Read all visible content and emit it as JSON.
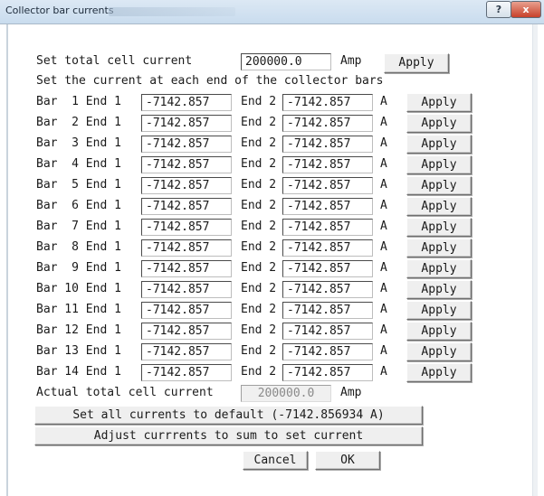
{
  "window": {
    "title": "Collector bar currents",
    "help_glyph": "?",
    "close_glyph": "x"
  },
  "total": {
    "label": "Set total cell current",
    "value": "200000.0",
    "unit": "Amp",
    "apply_label": "Apply"
  },
  "instruction": "Set the current at each end of the collector bars",
  "bars": [
    {
      "label": "Bar  1 End 1",
      "end1": "-7142.857",
      "end2_label": "End 2",
      "end2": "-7142.857",
      "unit": "A",
      "apply": "Apply"
    },
    {
      "label": "Bar  2 End 1",
      "end1": "-7142.857",
      "end2_label": "End 2",
      "end2": "-7142.857",
      "unit": "A",
      "apply": "Apply"
    },
    {
      "label": "Bar  3 End 1",
      "end1": "-7142.857",
      "end2_label": "End 2",
      "end2": "-7142.857",
      "unit": "A",
      "apply": "Apply"
    },
    {
      "label": "Bar  4 End 1",
      "end1": "-7142.857",
      "end2_label": "End 2",
      "end2": "-7142.857",
      "unit": "A",
      "apply": "Apply"
    },
    {
      "label": "Bar  5 End 1",
      "end1": "-7142.857",
      "end2_label": "End 2",
      "end2": "-7142.857",
      "unit": "A",
      "apply": "Apply"
    },
    {
      "label": "Bar  6 End 1",
      "end1": "-7142.857",
      "end2_label": "End 2",
      "end2": "-7142.857",
      "unit": "A",
      "apply": "Apply"
    },
    {
      "label": "Bar  7 End 1",
      "end1": "-7142.857",
      "end2_label": "End 2",
      "end2": "-7142.857",
      "unit": "A",
      "apply": "Apply"
    },
    {
      "label": "Bar  8 End 1",
      "end1": "-7142.857",
      "end2_label": "End 2",
      "end2": "-7142.857",
      "unit": "A",
      "apply": "Apply"
    },
    {
      "label": "Bar  9 End 1",
      "end1": "-7142.857",
      "end2_label": "End 2",
      "end2": "-7142.857",
      "unit": "A",
      "apply": "Apply"
    },
    {
      "label": "Bar 10 End 1",
      "end1": "-7142.857",
      "end2_label": "End 2",
      "end2": "-7142.857",
      "unit": "A",
      "apply": "Apply"
    },
    {
      "label": "Bar 11 End 1",
      "end1": "-7142.857",
      "end2_label": "End 2",
      "end2": "-7142.857",
      "unit": "A",
      "apply": "Apply"
    },
    {
      "label": "Bar 12 End 1",
      "end1": "-7142.857",
      "end2_label": "End 2",
      "end2": "-7142.857",
      "unit": "A",
      "apply": "Apply"
    },
    {
      "label": "Bar 13 End 1",
      "end1": "-7142.857",
      "end2_label": "End 2",
      "end2": "-7142.857",
      "unit": "A",
      "apply": "Apply"
    },
    {
      "label": "Bar 14 End 1",
      "end1": "-7142.857",
      "end2_label": "End 2",
      "end2": "-7142.857",
      "unit": "A",
      "apply": "Apply"
    }
  ],
  "actual": {
    "label": "Actual total cell current",
    "value": "200000.0",
    "unit": "Amp"
  },
  "buttons": {
    "set_default": "Set all currents to default (-7142.856934 A)",
    "adjust": "Adjust currrents to sum to set current",
    "cancel": "Cancel",
    "ok": "OK"
  }
}
